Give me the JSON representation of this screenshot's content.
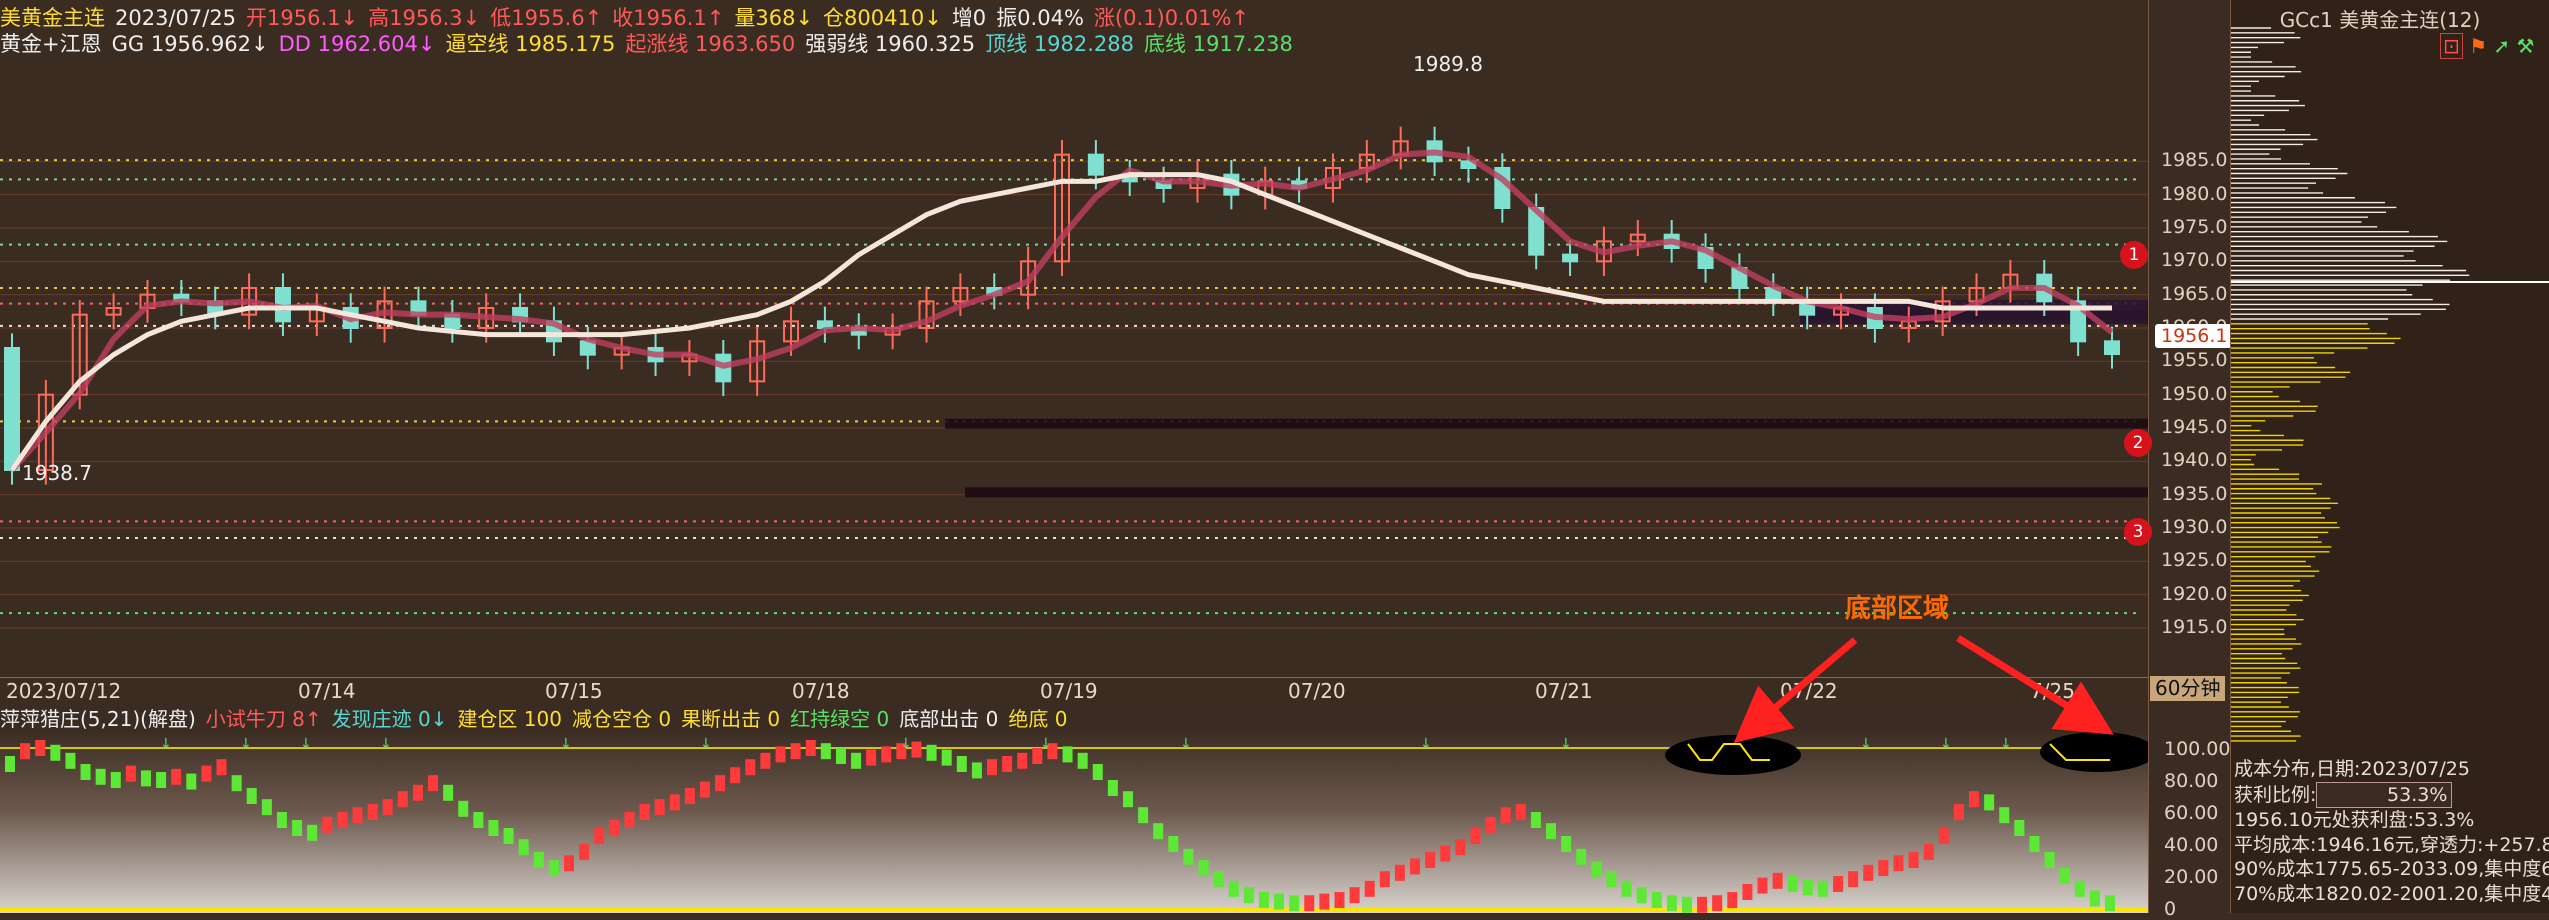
{
  "header": {
    "symbol": "美黄金主连",
    "date": "2023/07/25",
    "open": "开1956.1↓",
    "high": "高1956.3↓",
    "low": "低1955.6↑",
    "close": "收1956.1↑",
    "volume": "量368↓",
    "open_interest": "仓800410↓",
    "increase": "增0",
    "amplitude": "振0.04%",
    "change": "涨(0.1)0.01%↑",
    "indicator_name": "黄金+江恩",
    "gg": "GG 1956.962↓",
    "dd": "DD 1962.604↓",
    "bi_kong": "逼空线 1985.175",
    "qi_zhang": "起涨线 1963.650",
    "qiang_ruo": "强弱线 1960.325",
    "ding_xian": "顶线 1982.288",
    "di_xian": "底线 1917.238"
  },
  "chart_data": {
    "type": "candlestick",
    "y_axis_ticks": [
      "1985.0",
      "1980.0",
      "1975.0",
      "1970.0",
      "1965.0",
      "1960.0",
      "1955.0",
      "1950.0",
      "1945.0",
      "1940.0",
      "1935.0",
      "1930.0",
      "1925.0",
      "1920.0",
      "1915.0"
    ],
    "ylim": [
      1912,
      1996
    ],
    "x_labels": [
      "2023/07/12",
      "07/14",
      "07/15",
      "07/18",
      "07/19",
      "07/20",
      "07/21",
      "07/22",
      "7/25"
    ],
    "high_label": "1989.8",
    "low_label": "1938.7",
    "current_price": "1956.1",
    "series": [
      {
        "name": "candles",
        "close": [
          1938.7,
          1950,
          1962,
          1963,
          1965,
          1964,
          1962,
          1966,
          1961,
          1963,
          1960,
          1964,
          1962,
          1960,
          1963,
          1961,
          1958,
          1956,
          1957,
          1955,
          1956,
          1952,
          1958,
          1961,
          1960,
          1959,
          1960,
          1964,
          1966,
          1965,
          1970,
          1986,
          1983,
          1982,
          1981,
          1983,
          1980,
          1982,
          1981,
          1984,
          1986,
          1988,
          1985,
          1984,
          1978,
          1971,
          1970,
          1973,
          1974,
          1972,
          1969,
          1966,
          1964,
          1962,
          1963,
          1960,
          1961,
          1964,
          1966,
          1968,
          1964,
          1958,
          1956.1
        ]
      },
      {
        "name": "ma_long",
        "values": [
          1938.7,
          1946,
          1952,
          1956,
          1959,
          1961,
          1962,
          1963,
          1963,
          1963,
          1962,
          1961,
          1960,
          1959.5,
          1959,
          1959,
          1959,
          1959,
          1959,
          1959.5,
          1960,
          1961,
          1962,
          1964,
          1967,
          1971,
          1974,
          1977,
          1979,
          1980,
          1981,
          1982,
          1982,
          1983,
          1983,
          1983,
          1982,
          1980,
          1978,
          1976,
          1974,
          1972,
          1970,
          1968,
          1967,
          1966,
          1965,
          1964,
          1964,
          1964,
          1964,
          1964,
          1964,
          1964,
          1964,
          1964,
          1964,
          1963,
          1963,
          1963,
          1963,
          1963,
          1963
        ]
      }
    ],
    "levels": [
      {
        "name": "逼空线",
        "value": 1985.175,
        "color": "#e6c84a"
      },
      {
        "name": "顶线",
        "value": 1982.288,
        "color": "#7fd0a0"
      },
      {
        "name": "强弱线",
        "value": 1960.325,
        "color": "#e8e0d8"
      },
      {
        "name": "起涨线",
        "value": 1963.65,
        "color": "#ff6060"
      },
      {
        "name": "底线",
        "value": 1917.238,
        "color": "#59e069"
      },
      {
        "name": "",
        "value": 1966.0,
        "color": "#e6c84a"
      },
      {
        "name": "",
        "value": 1972.5,
        "color": "#7fd0a0"
      },
      {
        "name": "",
        "value": 1946.0,
        "color": "#e6c84a"
      },
      {
        "name": "",
        "value": 1931.0,
        "color": "#ff6060"
      },
      {
        "name": "",
        "value": 1928.5,
        "color": "#e8e0d8"
      }
    ],
    "markers": [
      "1",
      "2",
      "3"
    ]
  },
  "volume_profile": {
    "title": "GCc1 美黄金主连(12)",
    "info": {
      "line1": "成本分布,日期:2023/07/25",
      "ratio_label": "获利比例:",
      "ratio_value": "53.3%",
      "line3": "1956.10元处获利盘:53.3%",
      "line4": "平均成本:1946.16元,穿透力:+257.8",
      "line5": "90%成本1775.65-2033.09,集中度6.",
      "line6": "70%成本1820.02-2001.20,集中度4."
    }
  },
  "xaxis": {
    "timeframe": "60分钟"
  },
  "subchart": {
    "name": "萍萍猎庄(5,21)(解盘)",
    "items": [
      "小试牛刀 8↑",
      "发现庄迹 0↓",
      "建仓区 100",
      "减仓空仓 0",
      "果断出击 0",
      "红持绿空 0",
      "底部出击 0",
      "绝底 0"
    ],
    "y_ticks": [
      "100.00",
      "80.00",
      "60.00",
      "40.00",
      "20.00",
      "0"
    ],
    "values": [
      90,
      98,
      100,
      97,
      92,
      85,
      82,
      80,
      84,
      81,
      80,
      82,
      79,
      84,
      88,
      78,
      70,
      63,
      55,
      50,
      47,
      52,
      55,
      58,
      60,
      63,
      68,
      72,
      78,
      72,
      62,
      55,
      50,
      45,
      38,
      30,
      25,
      28,
      35,
      45,
      50,
      55,
      60,
      63,
      66,
      70,
      74,
      78,
      83,
      88,
      92,
      96,
      98,
      100,
      98,
      95,
      92,
      94,
      96,
      98,
      99,
      97,
      94,
      90,
      86,
      88,
      90,
      92,
      95,
      98,
      96,
      92,
      85,
      75,
      68,
      58,
      48,
      40,
      32,
      25,
      18,
      12,
      8,
      5,
      4,
      3,
      3,
      4,
      5,
      8,
      12,
      18,
      22,
      26,
      30,
      34,
      38,
      45,
      52,
      58,
      60,
      55,
      48,
      40,
      32,
      24,
      18,
      12,
      8,
      5,
      3,
      2,
      2,
      3,
      5,
      10,
      14,
      17,
      15,
      13,
      12,
      15,
      18,
      22,
      25,
      28,
      30,
      35,
      45,
      60,
      68,
      66,
      58,
      50,
      40,
      30,
      20,
      12,
      6,
      3
    ]
  },
  "annotation": {
    "text": "底部区域"
  }
}
